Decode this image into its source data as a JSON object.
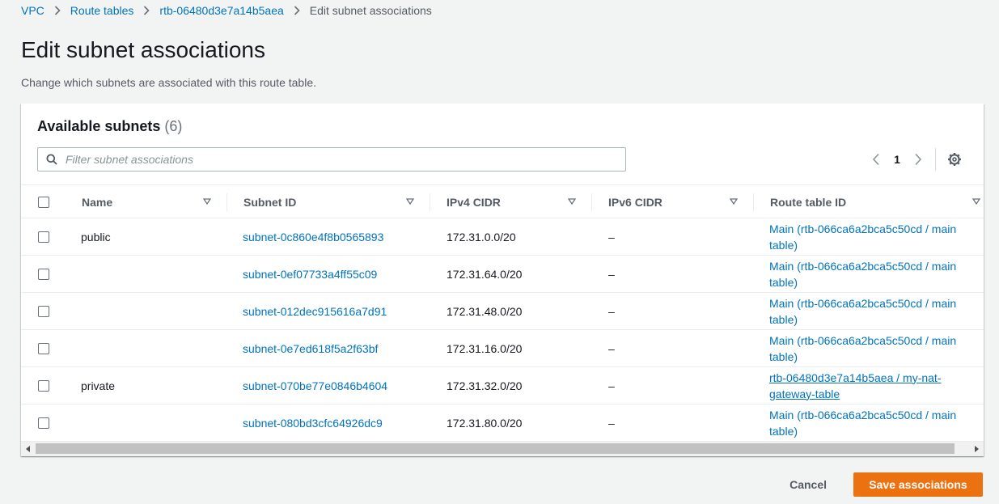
{
  "breadcrumb": {
    "items": [
      "VPC",
      "Route tables",
      "rtb-06480d3e7a14b5aea"
    ],
    "current": "Edit subnet associations"
  },
  "page": {
    "title": "Edit subnet associations",
    "description": "Change which subnets are associated with this route table."
  },
  "panel": {
    "title": "Available subnets",
    "count": "(6)",
    "filter_placeholder": "Filter subnet associations",
    "filter_value": "",
    "page_number": "1"
  },
  "table": {
    "columns": [
      "Name",
      "Subnet ID",
      "IPv4 CIDR",
      "IPv6 CIDR",
      "Route table ID"
    ],
    "rows": [
      {
        "name": "public",
        "subnet_id": "subnet-0c860e4f8b0565893",
        "ipv4": "172.31.0.0/20",
        "ipv6": "–",
        "route_table": "Main (rtb-066ca6a2bca5c50cd / main table)",
        "underline": false
      },
      {
        "name": "",
        "subnet_id": "subnet-0ef07733a4ff55c09",
        "ipv4": "172.31.64.0/20",
        "ipv6": "–",
        "route_table": "Main (rtb-066ca6a2bca5c50cd / main table)",
        "underline": false
      },
      {
        "name": "",
        "subnet_id": "subnet-012dec915616a7d91",
        "ipv4": "172.31.48.0/20",
        "ipv6": "–",
        "route_table": "Main (rtb-066ca6a2bca5c50cd / main table)",
        "underline": false
      },
      {
        "name": "",
        "subnet_id": "subnet-0e7ed618f5a2f63bf",
        "ipv4": "172.31.16.0/20",
        "ipv6": "–",
        "route_table": "Main (rtb-066ca6a2bca5c50cd / main table)",
        "underline": false
      },
      {
        "name": "private",
        "subnet_id": "subnet-070be77e0846b4604",
        "ipv4": "172.31.32.0/20",
        "ipv6": "–",
        "route_table": "rtb-06480d3e7a14b5aea / my-nat-gateway-table",
        "underline": true
      },
      {
        "name": "",
        "subnet_id": "subnet-080bd3cfc64926dc9",
        "ipv4": "172.31.80.0/20",
        "ipv6": "–",
        "route_table": "Main (rtb-066ca6a2bca5c50cd / main table)",
        "underline": false
      }
    ]
  },
  "actions": {
    "cancel_label": "Cancel",
    "save_label": "Save associations"
  },
  "colors": {
    "link": "#0073bb",
    "primary": "#ec7211",
    "background": "#f2f3f3"
  }
}
